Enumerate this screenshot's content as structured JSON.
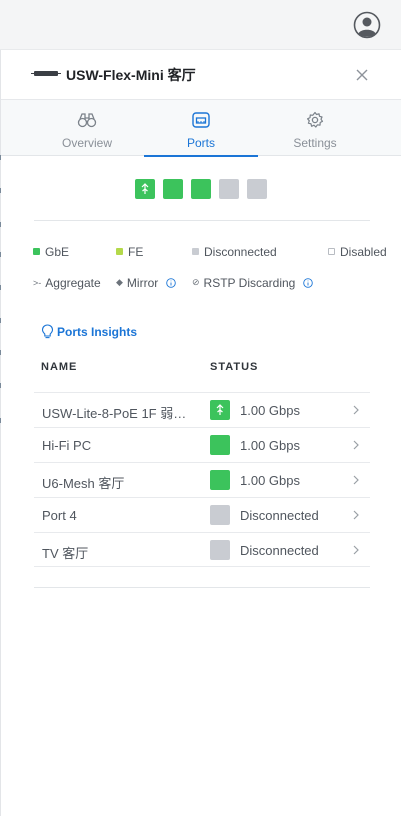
{
  "header": {
    "device_name": "USW-Flex-Mini 客厅"
  },
  "tabs": [
    {
      "label": "Overview",
      "icon": "binoculars-icon"
    },
    {
      "label": "Ports",
      "icon": "ports-icon",
      "active": true
    },
    {
      "label": "Settings",
      "icon": "gear-icon"
    }
  ],
  "port_strip": [
    {
      "state": "uplink",
      "color": "#3cc35c"
    },
    {
      "state": "gbe",
      "color": "#3cc35c"
    },
    {
      "state": "gbe",
      "color": "#3cc35c"
    },
    {
      "state": "disconnected",
      "color": "#c9ccd2"
    },
    {
      "state": "disconnected",
      "color": "#c9ccd2"
    }
  ],
  "legend": {
    "gbe": "GbE",
    "fe": "FE",
    "disconnected": "Disconnected",
    "disabled": "Disabled",
    "aggregate": "Aggregate",
    "mirror": "Mirror",
    "rstp": "RSTP Discarding"
  },
  "colors": {
    "gbe": "#3cc35c",
    "fe": "#b4d94a",
    "disconnected": "#c9ccd2",
    "accent": "#1b75d6"
  },
  "insights_label": "Ports Insights",
  "table": {
    "columns": [
      "NAME",
      "STATUS"
    ],
    "rows": [
      {
        "name": "USW-Lite-8-PoE 1F 弱…",
        "status": "1.00 Gbps",
        "state": "uplink"
      },
      {
        "name": "Hi-Fi PC",
        "status": "1.00 Gbps",
        "state": "gbe"
      },
      {
        "name": "U6-Mesh 客厅",
        "status": "1.00 Gbps",
        "state": "gbe"
      },
      {
        "name": "Port 4",
        "status": "Disconnected",
        "state": "disconnected"
      },
      {
        "name": "TV 客厅",
        "status": "Disconnected",
        "state": "disconnected"
      }
    ]
  }
}
